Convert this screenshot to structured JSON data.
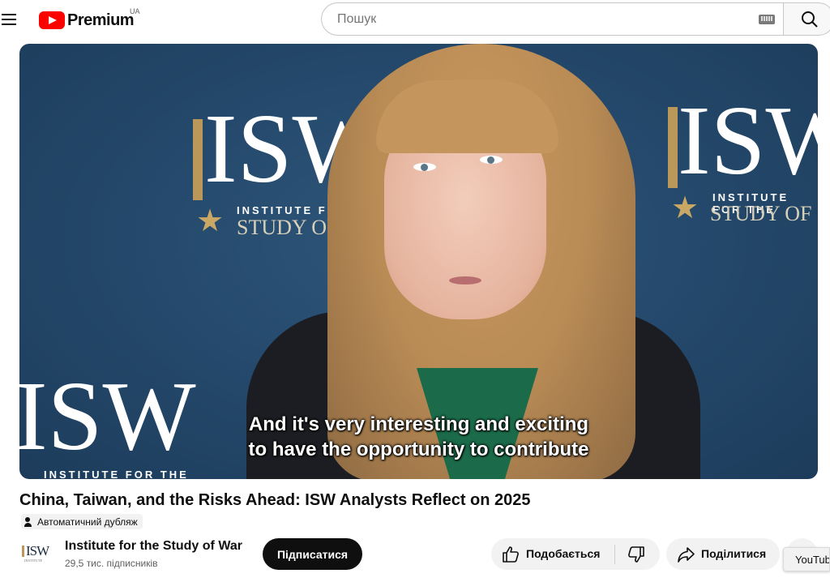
{
  "header": {
    "logo_text": "Premium",
    "country_code": "UA",
    "search_placeholder": "Пошук"
  },
  "video": {
    "subtitle_line1": "And it's very interesting and exciting",
    "subtitle_line2": "to have the opportunity to contribute",
    "backdrop": {
      "logo_letters": "ISW",
      "logo_line1": "INSTITUTE FOR THE",
      "logo_line2": "STUDY OF",
      "left_tagline": "INSTITUTE FOR THE"
    }
  },
  "title": "China, Taiwan, and the Risks Ahead: ISW Analysts Reflect on 2025",
  "auto_dub_label": "Автоматичний дубляж",
  "channel": {
    "logo_text": "ISW",
    "logo_subtext": "INSTITUTE",
    "name": "Institute for the Study of War",
    "subscribers": "29,5 тис. підписників",
    "subscribe_label": "Підписатися"
  },
  "actions": {
    "like_label": "Подобається",
    "share_label": "Поділитися"
  },
  "tooltip": "YouTube",
  "colors": {
    "brand_red": "#ff0000",
    "backdrop_blue": "#254a6d",
    "isw_gold": "#b9985a"
  },
  "icons": [
    "menu-icon",
    "youtube-logo-icon",
    "keyboard-icon",
    "search-icon",
    "auto-dub-icon",
    "like-icon",
    "dislike-icon",
    "share-icon"
  ]
}
